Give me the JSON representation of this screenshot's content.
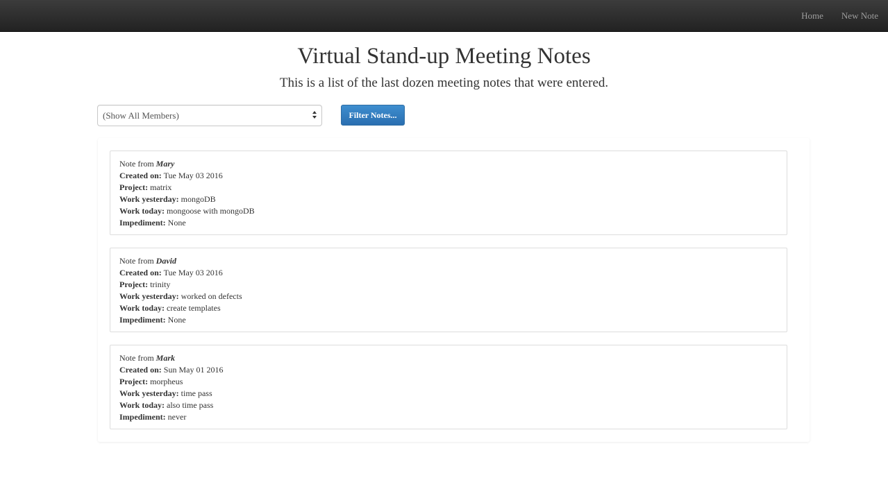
{
  "nav": {
    "home": "Home",
    "new_note": "New Note"
  },
  "header": {
    "title": "Virtual Stand-up Meeting Notes",
    "subtitle": "This is a list of the last dozen meeting notes that were entered."
  },
  "filter": {
    "selected": "(Show All Members)",
    "button_label": "Filter Notes..."
  },
  "labels": {
    "note_from": "Note from",
    "created_on": "Created on:",
    "project": "Project:",
    "work_yesterday": "Work yesterday:",
    "work_today": "Work today:",
    "impediment": "Impediment:"
  },
  "notes": [
    {
      "author": "Mary",
      "created_on": "Tue May 03 2016",
      "project": "matrix",
      "work_yesterday": "mongoDB",
      "work_today": "mongoose with mongoDB",
      "impediment": "None"
    },
    {
      "author": "David",
      "created_on": "Tue May 03 2016",
      "project": "trinity",
      "work_yesterday": "worked on defects",
      "work_today": "create templates",
      "impediment": "None"
    },
    {
      "author": "Mark",
      "created_on": "Sun May 01 2016",
      "project": "morpheus",
      "work_yesterday": "time pass",
      "work_today": "also time pass",
      "impediment": "never"
    }
  ]
}
